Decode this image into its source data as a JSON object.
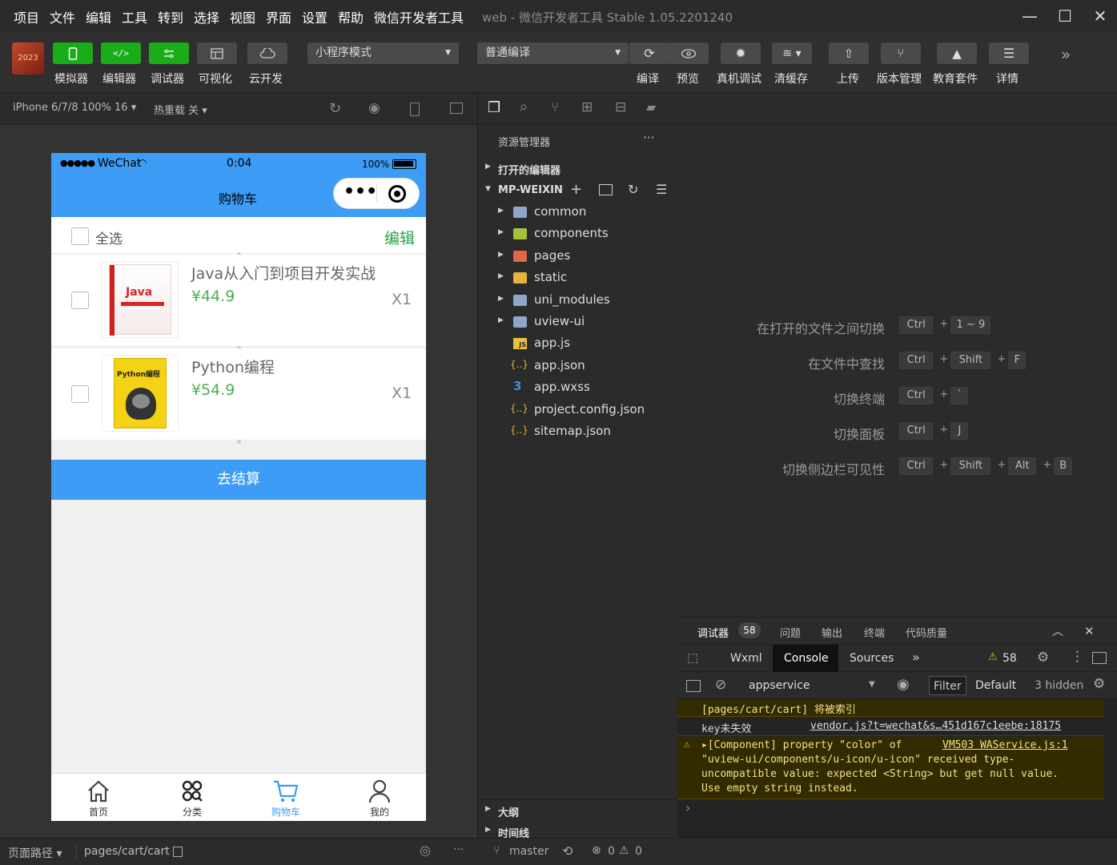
{
  "menubar": {
    "items": [
      "项目",
      "文件",
      "编辑",
      "工具",
      "转到",
      "选择",
      "视图",
      "界面",
      "设置",
      "帮助",
      "微信开发者工具"
    ],
    "window_title": "web - 微信开发者工具 Stable 1.05.2201240",
    "minimize_symbol": "—",
    "maximize_symbol": "☐",
    "close_symbol": "✕"
  },
  "toolbar": {
    "simulator_label": "模拟器",
    "editor_label": "编辑器",
    "debugger_label": "调试器",
    "visual_label": "可视化",
    "cloud_label": "云开发",
    "mode_select": "小程序模式",
    "compile_select": "普通编译",
    "compile_label": "编译",
    "preview_label": "预览",
    "remote_debug_label": "真机调试",
    "clear_cache_label": "清缓存",
    "upload_label": "上传",
    "version_label": "版本管理",
    "edu_label": "教育套件",
    "details_label": "详情",
    "more_symbol": "»",
    "avatar_text": "2023"
  },
  "simulator": {
    "device_select": "iPhone 6/7/8 100% 16 ▾",
    "hot_reload": "热重载 关 ▾"
  },
  "phone": {
    "signal": "●●●●●",
    "carrier": "WeChat",
    "time": "0:04",
    "battery": "100%",
    "nav_title": "购物车",
    "capsule_dots": "•••",
    "select_all": "全选",
    "edit": "编辑",
    "items": [
      {
        "title": "Java从入门到项目开发实战",
        "price": "¥44.9",
        "qty": "X1",
        "cover_text": "Java"
      },
      {
        "title": "Python编程",
        "price": "¥54.9",
        "qty": "X1",
        "cover_text": "Python编程"
      }
    ],
    "checkout": "去结算",
    "tabs": [
      {
        "label": "首页",
        "active": false
      },
      {
        "label": "分类",
        "active": false
      },
      {
        "label": "购物车",
        "active": true
      },
      {
        "label": "我的",
        "active": false
      }
    ],
    "active_color": "#3d9cf5"
  },
  "sim_bottom": {
    "page_path_label": "页面路径 ▾",
    "page_path": "pages/cart/cart",
    "more": "···"
  },
  "explorer": {
    "title": "资源管理器",
    "more": "···",
    "open_editors": "打开的编辑器",
    "project": "MP-WEIXIN",
    "files": [
      {
        "name": "common",
        "type": "folder",
        "color": "#8fa7c9"
      },
      {
        "name": "components",
        "type": "folder",
        "color": "#a8c23a"
      },
      {
        "name": "pages",
        "type": "folder",
        "color": "#e0674a"
      },
      {
        "name": "static",
        "type": "folder",
        "color": "#e5b23a"
      },
      {
        "name": "uni_modules",
        "type": "folder",
        "color": "#8fa7c9"
      },
      {
        "name": "uview-ui",
        "type": "folder",
        "color": "#8fa7c9"
      },
      {
        "name": "app.js",
        "type": "js"
      },
      {
        "name": "app.json",
        "type": "json"
      },
      {
        "name": "app.wxss",
        "type": "css"
      },
      {
        "name": "project.config.json",
        "type": "json"
      },
      {
        "name": "sitemap.json",
        "type": "json"
      }
    ],
    "outline": "大纲",
    "timeline": "时间线"
  },
  "editor_hints": [
    {
      "label": "在打开的文件之间切换",
      "keys": [
        "Ctrl",
        "1 ~ 9"
      ]
    },
    {
      "label": "在文件中查找",
      "keys": [
        "Ctrl",
        "Shift",
        "F"
      ]
    },
    {
      "label": "切换终端",
      "keys": [
        "Ctrl",
        "`"
      ]
    },
    {
      "label": "切换面板",
      "keys": [
        "Ctrl",
        "J"
      ]
    },
    {
      "label": "切换侧边栏可见性",
      "keys": [
        "Ctrl",
        "Shift",
        "Alt",
        "B"
      ]
    }
  ],
  "devtools": {
    "tabs": [
      "调试器",
      "问题",
      "输出",
      "终端",
      "代码质量"
    ],
    "badge": "58",
    "subtabs": [
      "Wxml",
      "Console",
      "Sources"
    ],
    "more": "»",
    "warn_count": "58",
    "context": "appservice",
    "filter": "Filter",
    "level": "Default",
    "hidden": "3 hidden",
    "lines": {
      "l1": "[pages/cart/cart] 将被索引",
      "l2_text": "key未失效",
      "l2_link": "vendor.js?t=wechat&s…451d167c1eebe:18175",
      "l3_link": "VM503 WAService.js:1",
      "l3_a": "▸[Component] property \"color\" of",
      "l3_b": "\"uview-ui/components/u-icon/u-icon\" received type-",
      "l3_c": "uncompatible value: expected <String> but get null value.",
      "l3_d": "Use empty string instead.",
      "prompt": "›"
    }
  },
  "statusbar": {
    "branch": "master",
    "errors": "0",
    "warnings": "0"
  }
}
